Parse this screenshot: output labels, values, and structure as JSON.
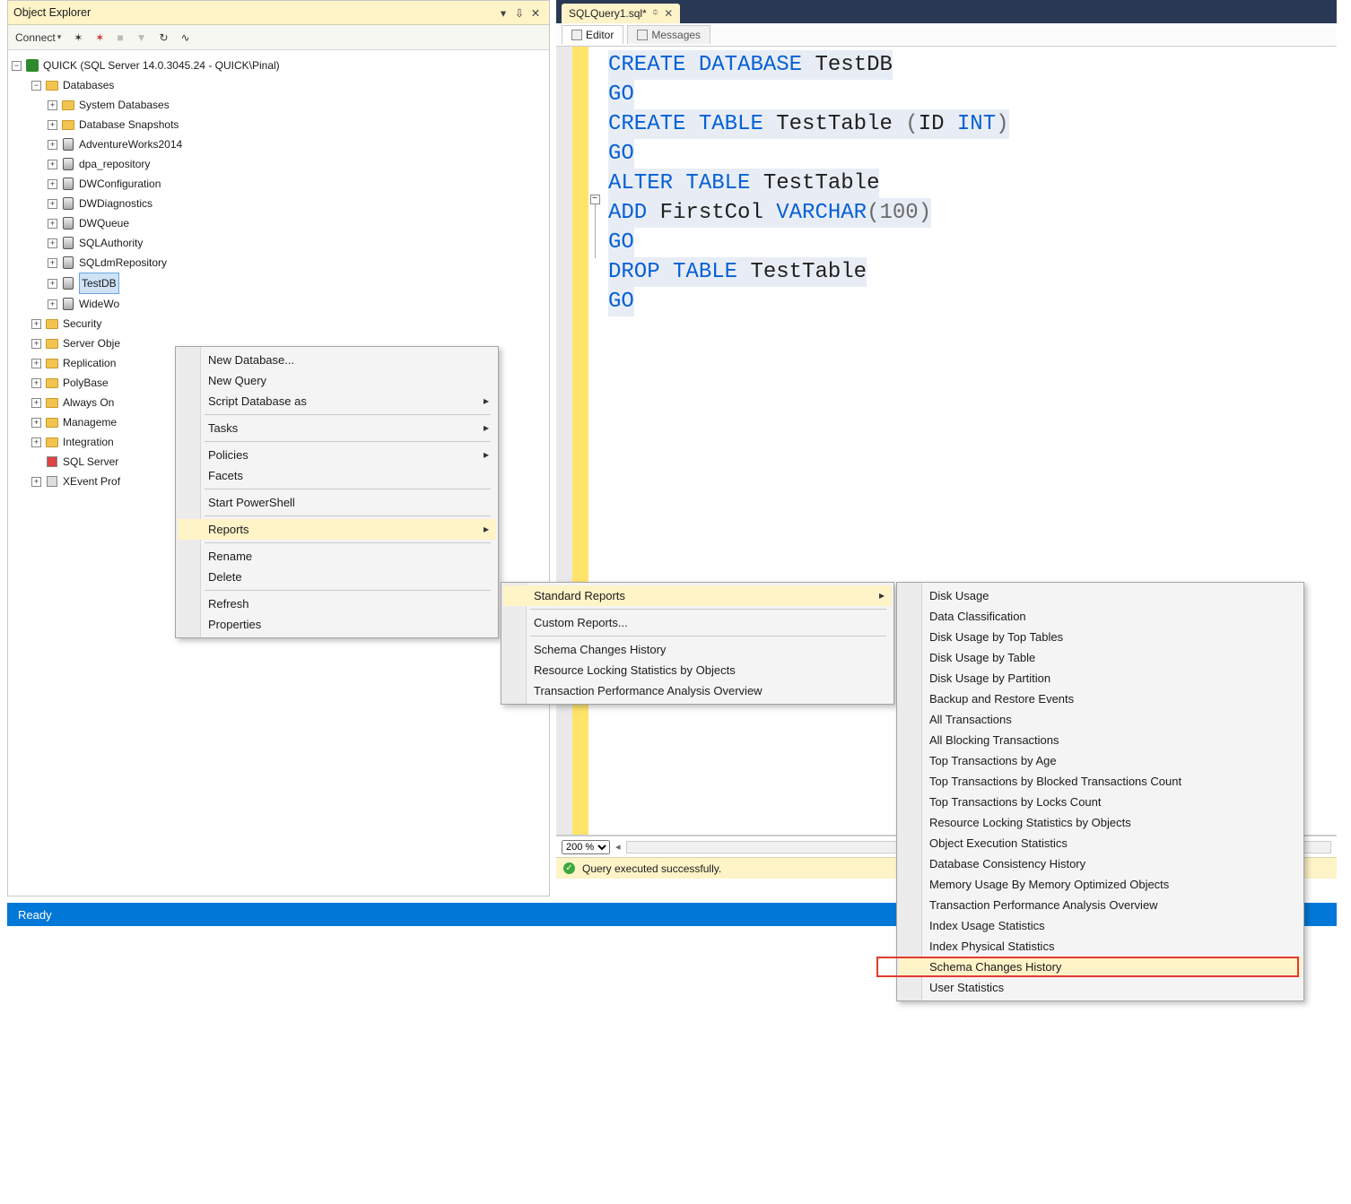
{
  "objectExplorer": {
    "title": "Object Explorer",
    "connectLabel": "Connect",
    "server": "QUICK (SQL Server 14.0.3045.24 - QUICK\\Pinal)",
    "databasesLabel": "Databases",
    "children": [
      "System Databases",
      "Database Snapshots"
    ],
    "databases": [
      "AdventureWorks2014",
      "dpa_repository",
      "DWConfiguration",
      "DWDiagnostics",
      "DWQueue",
      "SQLAuthority",
      "SQLdmRepository",
      "TestDB",
      "WideWo"
    ],
    "serverFolders": [
      "Security",
      "Server Obje",
      "Replication",
      "PolyBase",
      "Always On",
      "Manageme",
      "Integration"
    ],
    "sqlAgent": "SQL Server",
    "xevent": "XEvent Prof"
  },
  "docTab": {
    "name": "SQLQuery1.sql*"
  },
  "innerTabs": {
    "editor": "Editor",
    "messages": "Messages"
  },
  "sql": {
    "l1_kw1": "CREATE",
    "l1_kw2": "DATABASE",
    "l1_id": "TestDB",
    "l2": "GO",
    "l3_kw1": "CREATE",
    "l3_kw2": "TABLE",
    "l3_id": "TestTable",
    "l3_p1": "(",
    "l3_id2": "ID",
    "l3_ty": "INT",
    "l3_p2": ")",
    "l4": "GO",
    "l5_kw1": "ALTER",
    "l5_kw2": "TABLE",
    "l5_id": "TestTable",
    "l6_kw1": "ADD",
    "l6_id": "FirstCol",
    "l6_ty": "VARCHAR",
    "l6_p1": "(",
    "l6_num": "100",
    "l6_p2": ")",
    "l7": "GO",
    "l8_kw1": "DROP",
    "l8_kw2": "TABLE",
    "l8_id": "TestTable",
    "l9": "GO"
  },
  "zoom": "200 %",
  "statusMsg": "Query executed successfully.",
  "readyText": "Ready",
  "ctx1": {
    "newDb": "New Database...",
    "newQuery": "New Query",
    "script": "Script Database as",
    "tasks": "Tasks",
    "policies": "Policies",
    "facets": "Facets",
    "ps": "Start PowerShell",
    "reports": "Reports",
    "rename": "Rename",
    "delete": "Delete",
    "refresh": "Refresh",
    "properties": "Properties"
  },
  "ctx2": {
    "standard": "Standard Reports",
    "custom": "Custom Reports...",
    "schema": "Schema Changes History",
    "locking": "Resource Locking Statistics by Objects",
    "txn": "Transaction Performance Analysis Overview"
  },
  "ctx3": [
    "Disk Usage",
    "Data Classification",
    "Disk Usage by Top Tables",
    "Disk Usage by Table",
    "Disk Usage by Partition",
    "Backup and Restore Events",
    "All Transactions",
    "All Blocking Transactions",
    "Top Transactions by Age",
    "Top Transactions by Blocked Transactions Count",
    "Top Transactions by Locks Count",
    "Resource Locking Statistics by Objects",
    "Object Execution Statistics",
    "Database Consistency History",
    "Memory Usage By Memory Optimized Objects",
    "Transaction Performance Analysis Overview",
    "Index Usage Statistics",
    "Index Physical Statistics",
    "Schema Changes History",
    "User Statistics"
  ],
  "ctx3Highlight": "Schema Changes History"
}
